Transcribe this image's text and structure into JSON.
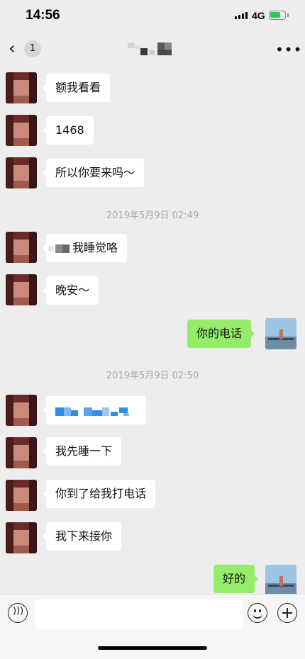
{
  "status": {
    "time": "14:56",
    "network": "4G"
  },
  "nav": {
    "back_icon": "chevron-left-icon",
    "unread_count": "1",
    "more_icon": "more-dots-icon"
  },
  "colors": {
    "background": "#ededed",
    "incoming_bubble": "#ffffff",
    "outgoing_bubble": "#95ec69",
    "timestamp": "#a8a8a8"
  },
  "messages": [
    {
      "from": "them",
      "text": "额我看看"
    },
    {
      "from": "them",
      "text": "1468"
    },
    {
      "from": "them",
      "text": "所以你要来吗～"
    },
    {
      "type": "timestamp",
      "text": "2019年5月9日 02:49"
    },
    {
      "from": "them",
      "text": "我睡觉咯",
      "prefix_redacted": true
    },
    {
      "from": "them",
      "text": "晚安～"
    },
    {
      "from": "me",
      "text": "你的电话"
    },
    {
      "type": "timestamp",
      "text": "2019年5月9日 02:50"
    },
    {
      "from": "them",
      "text": "",
      "redacted": true
    },
    {
      "from": "them",
      "text": "我先睡一下"
    },
    {
      "from": "them",
      "text": "你到了给我打电话"
    },
    {
      "from": "them",
      "text": "我下来接你"
    },
    {
      "from": "me",
      "text": "好的"
    }
  ],
  "input_bar": {
    "voice_icon": "voice-icon",
    "emoji_icon": "emoji-icon",
    "plus_icon": "plus-icon",
    "value": ""
  }
}
